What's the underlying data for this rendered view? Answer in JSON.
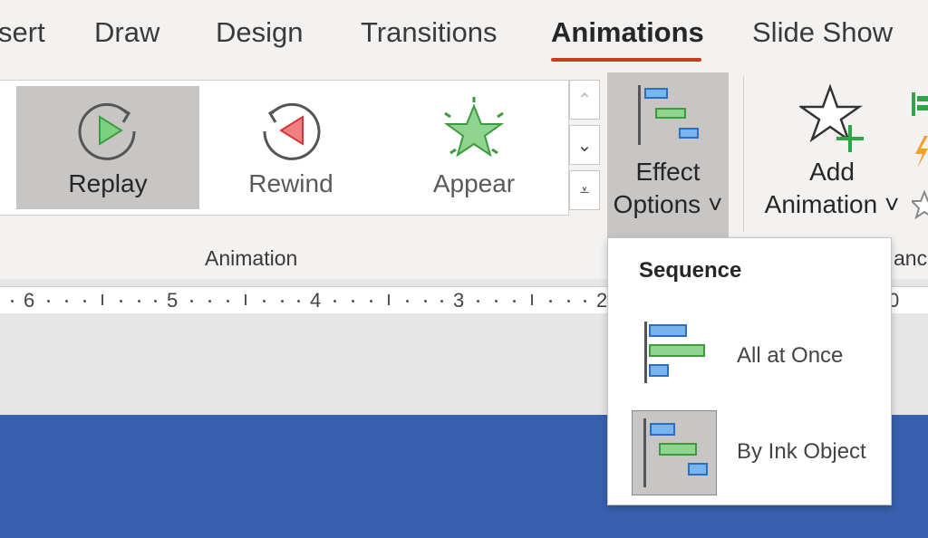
{
  "tabs": [
    "sert",
    "Draw",
    "Design",
    "Transitions",
    "Animations",
    "Slide Show"
  ],
  "active_tab": "Animations",
  "gallery": {
    "items": [
      {
        "label": "Replay",
        "icon": "replay-icon",
        "selected": true
      },
      {
        "label": "Rewind",
        "icon": "rewind-icon",
        "selected": false
      },
      {
        "label": "Appear",
        "icon": "appear-star-icon",
        "selected": false
      }
    ]
  },
  "animation_group_label": "Animation",
  "effect_options": {
    "line1": "Effect",
    "line2": "Options ˅"
  },
  "add_animation": {
    "line1": "Add",
    "line2": "Animation ˅"
  },
  "right_clip_label": "anc",
  "ruler_numbers": [
    "6",
    "5",
    "4",
    "3",
    "2",
    "0"
  ],
  "dropdown": {
    "header": "Sequence",
    "items": [
      {
        "label": "All at Once",
        "selected": false
      },
      {
        "label": "By Ink Object",
        "selected": true
      }
    ]
  },
  "colors": {
    "accent_underline": "#c43e1c",
    "slide_blue": "#3760ae",
    "selected_bg": "#c8c6c4",
    "green": "#5cb85c",
    "red": "#e8474f",
    "blue_bar": "#4a90d9"
  }
}
